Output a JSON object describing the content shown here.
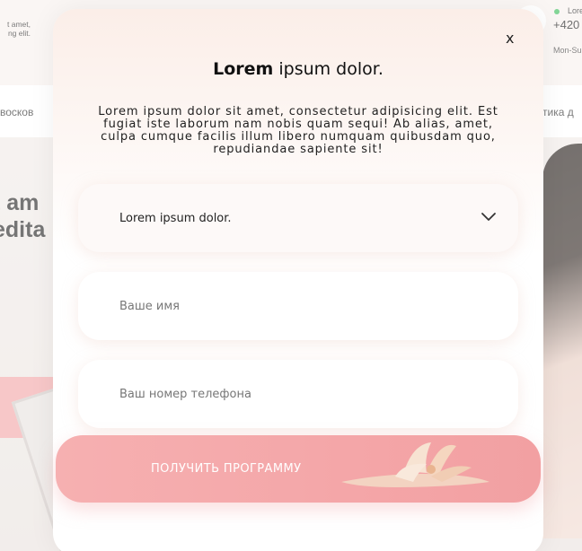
{
  "background": {
    "top_left_text_line1": "t amet,",
    "top_left_text_line2": "ng elit.",
    "status_text": "Lore",
    "phone": "+420",
    "hours": "Mon-Su",
    "nav_left": "восков",
    "nav_right": "тика д",
    "hero_line1": "t am",
    "hero_line2": "edita"
  },
  "modal": {
    "close_label": "x",
    "title_bold": "Lorem",
    "title_rest": " ipsum dolor.",
    "description": "Lorem ipsum dolor sit amet, consectetur adipisicing elit. Est fugiat iste laborum nam nobis quam sequi! Ab alias, amet, culpa cumque facilis illum libero numquam quibusdam quo, repudiandae sapiente sit!",
    "select": {
      "value": "Lorem ipsum dolor."
    },
    "name_field": {
      "placeholder": "Ваше имя"
    },
    "phone_field": {
      "placeholder": "Ваш номер телефона"
    },
    "submit_label": "ПОЛУЧИТЬ ПРОГРАММУ"
  },
  "colors": {
    "accent_pink": "#f4a6a8",
    "status_green": "#3fbf5f"
  }
}
